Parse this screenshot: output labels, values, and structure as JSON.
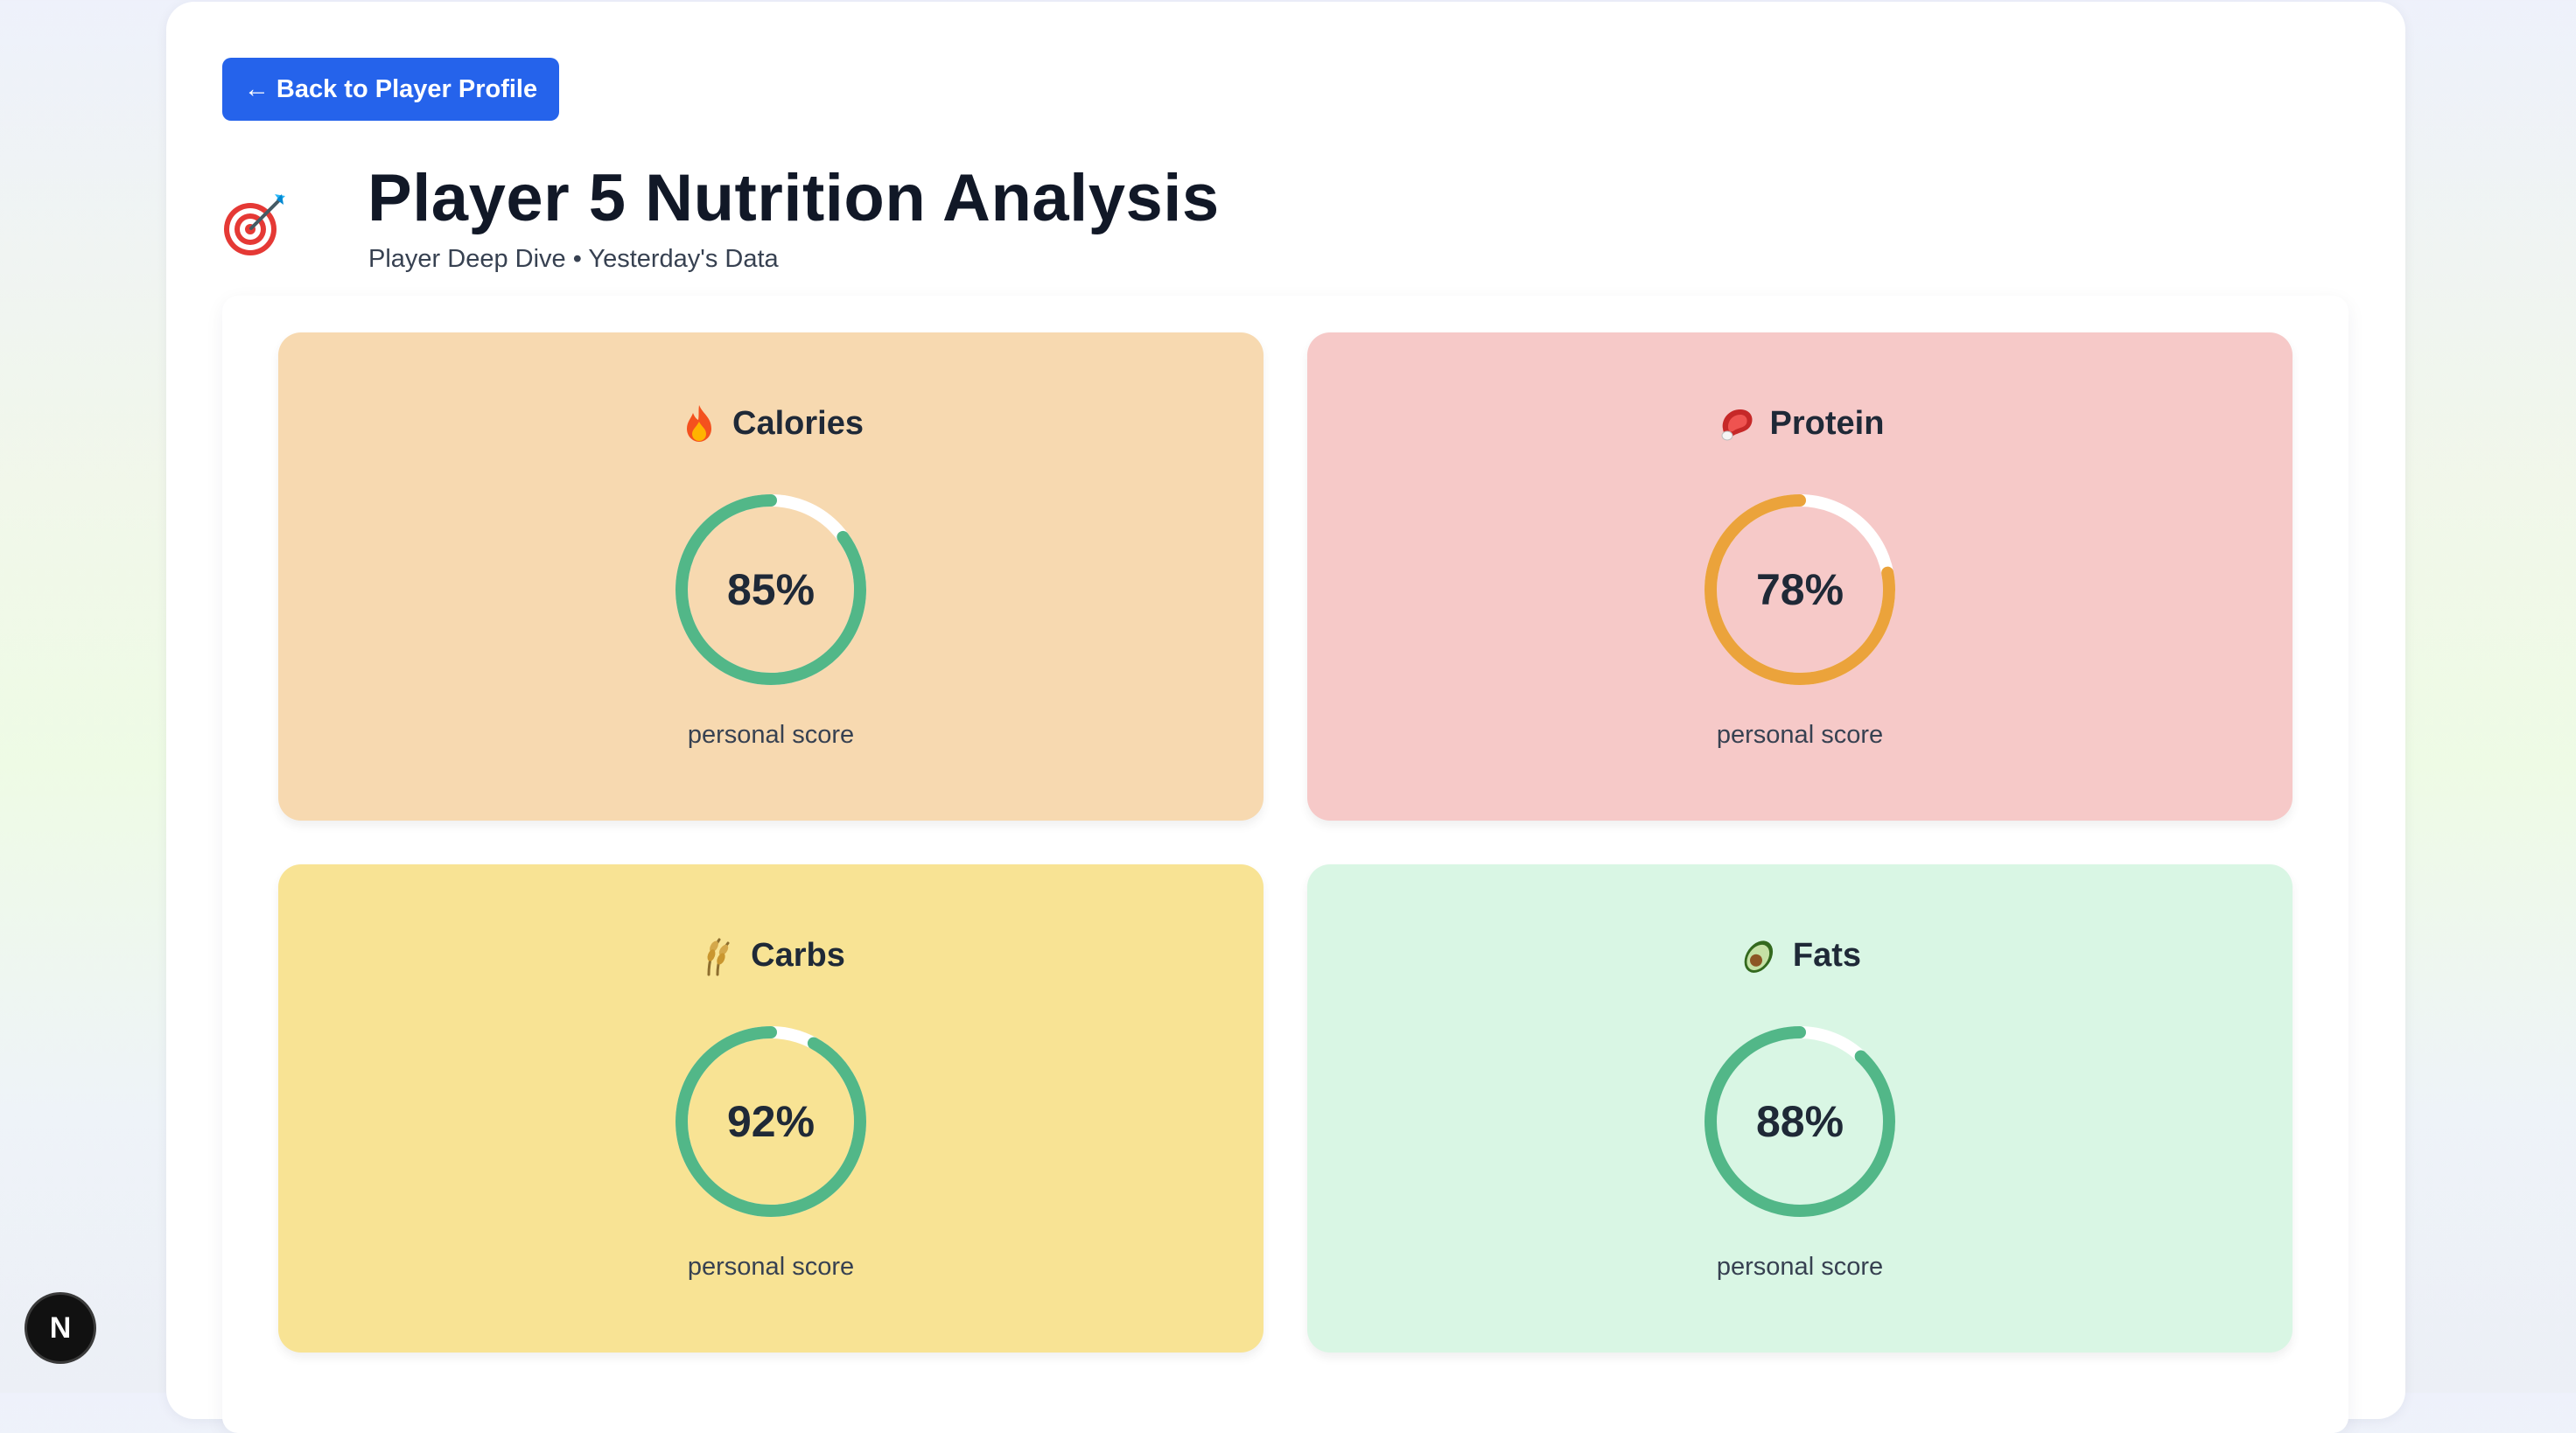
{
  "back_button": {
    "arrow": "←",
    "label": "Back to Player Profile"
  },
  "header": {
    "icon": "target-icon",
    "title": "Player 5 Nutrition Analysis",
    "subtitle": "Player Deep Dive • Yesterday's Data"
  },
  "cards": [
    {
      "label": "Calories",
      "icon": "fire-icon",
      "score_text": "85%",
      "score": 0.85,
      "caption": "personal score",
      "bg_color": "#f7d9b0",
      "ring_color": "#52b788"
    },
    {
      "label": "Protein",
      "icon": "meat-icon",
      "score_text": "78%",
      "score": 0.78,
      "caption": "personal score",
      "bg_color": "#f6c9c8",
      "ring_color": "#eba33b"
    },
    {
      "label": "Carbs",
      "icon": "grain-icon",
      "score_text": "92%",
      "score": 0.92,
      "caption": "personal score",
      "bg_color": "#f8e394",
      "ring_color": "#52b788"
    },
    {
      "label": "Fats",
      "icon": "avocado-icon",
      "score_text": "88%",
      "score": 0.88,
      "caption": "personal score",
      "bg_color": "#d9f6e4",
      "ring_color": "#52b788"
    }
  ],
  "dev_badge": {
    "label": "N"
  }
}
